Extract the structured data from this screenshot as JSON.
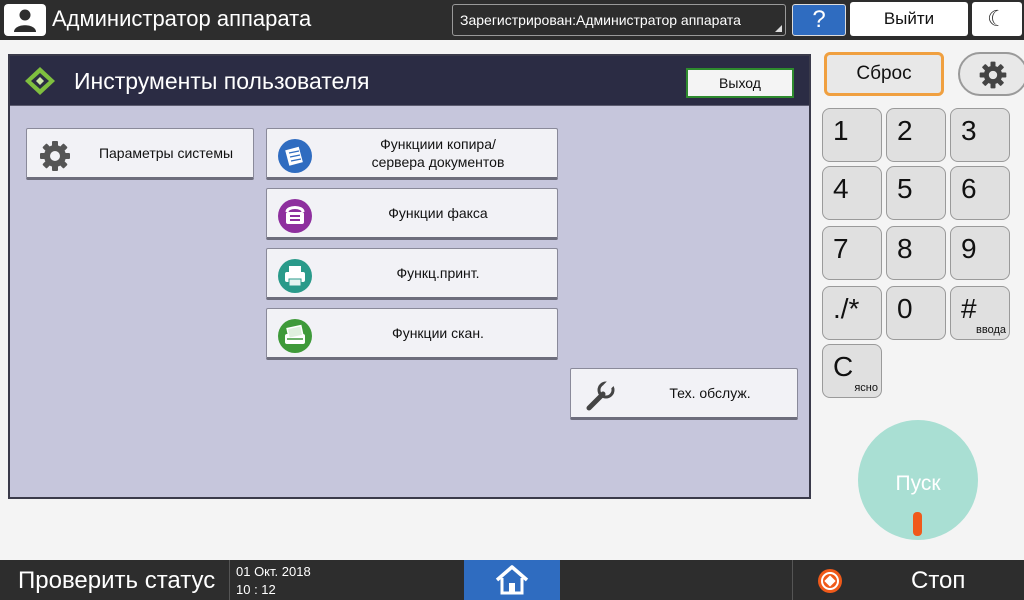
{
  "header": {
    "title": "Администратор аппарата",
    "login_status": "Зарегистрирован:Администратор аппарата",
    "help_label": "?",
    "logout_label": "Выйти"
  },
  "panel": {
    "title": "Инструменты пользователя",
    "exit_label": "Выход",
    "buttons": {
      "system_settings": "Параметры системы",
      "copier_line1": "Функциии копира/",
      "copier_line2": "сервера документов",
      "fax": "Функции факса",
      "printer": "Функц.принт.",
      "scanner": "Функции скан.",
      "maintenance": "Тех. обслуж."
    },
    "icon_colors": {
      "copier": "#2f6cc0",
      "fax": "#8e2f9e",
      "printer": "#2a9a8a",
      "scanner": "#3f9a3a"
    }
  },
  "keypad": {
    "reset_label": "Сброс",
    "keys": [
      {
        "main": "1",
        "sub": ""
      },
      {
        "main": "2",
        "sub": ""
      },
      {
        "main": "3",
        "sub": ""
      },
      {
        "main": "4",
        "sub": ""
      },
      {
        "main": "5",
        "sub": ""
      },
      {
        "main": "6",
        "sub": ""
      },
      {
        "main": "7",
        "sub": ""
      },
      {
        "main": "8",
        "sub": ""
      },
      {
        "main": "9",
        "sub": ""
      },
      {
        "main": "./*",
        "sub": ""
      },
      {
        "main": "0",
        "sub": ""
      },
      {
        "main": "#",
        "sub": "ввода"
      },
      {
        "main": "C",
        "sub": "ясно"
      }
    ],
    "start_label": "Пуск"
  },
  "footer": {
    "status_label": "Проверить статус",
    "date": "01 Окт. 2018",
    "time": "10 : 12",
    "stop_label": "Стоп"
  },
  "colors": {
    "bar": "#2d2d2d",
    "accent_blue": "#2f6cc0",
    "panel_bg": "#c6c6dc",
    "panel_header": "#2b2c44",
    "reset_border": "#f0a040",
    "start": "#a9dfd3",
    "stop": "#f05a1a"
  }
}
